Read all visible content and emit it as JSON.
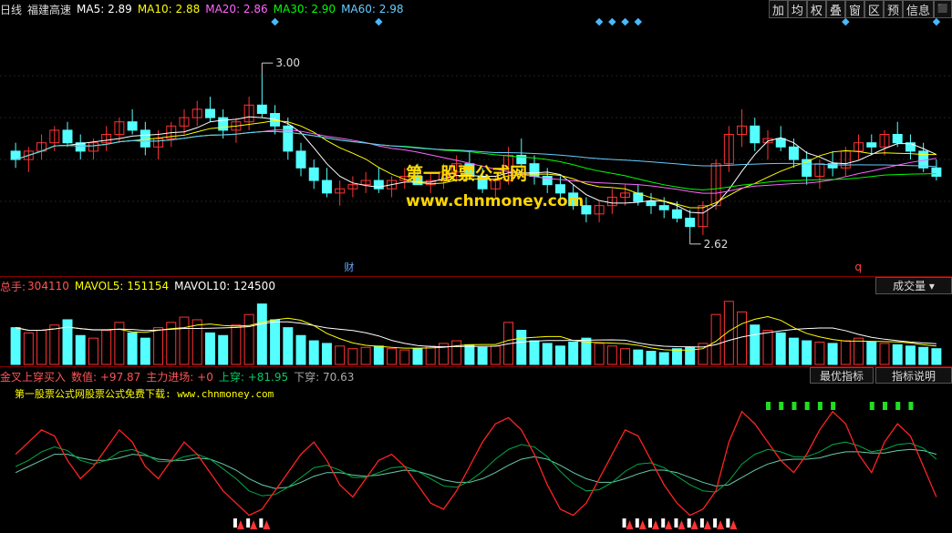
{
  "header": {
    "period": "日线",
    "stock": "福建高速",
    "ma": [
      {
        "label": "MA5: 2.89",
        "color": "#ffffff"
      },
      {
        "label": "MA10: 2.88",
        "color": "#ffff00"
      },
      {
        "label": "MA20: 2.86",
        "color": "#ff66ff"
      },
      {
        "label": "MA30: 2.90",
        "color": "#00ff00"
      },
      {
        "label": "MA60: 2.98",
        "color": "#66ccff"
      }
    ]
  },
  "toolbar": [
    "加",
    "均",
    "权",
    "叠",
    "窗",
    "区",
    "预",
    "信息",
    "⬛"
  ],
  "volume_panel": {
    "label_total": "总手:",
    "total_value": "304110",
    "mavol5": "MAVOL5: 151154",
    "mavol10": "MAVOL10: 124500",
    "selector": "成交量"
  },
  "indicator_panel": {
    "title": "金叉上穿买入",
    "value_label": "数值: +97.87",
    "main_flow": "主力进场: +0",
    "up_cross": "上穿: +81.95",
    "down_cross": "下穿: 70.63",
    "best_button": "最优指标",
    "help_button": "指标说明",
    "promo": "第一股票公式网股票公式免费下载: www.chnmoney.com"
  },
  "watermark": {
    "cn": "第一股票公式网",
    "url": "www.chnmoney.com"
  },
  "chart_data": {
    "type": "candlestick",
    "annotations": {
      "high": "3.00",
      "low": "2.62",
      "marker_cai": "财",
      "marker_q": "q"
    },
    "colors": {
      "up": "#ff3333",
      "down": "#54ffff",
      "ma5": "#ffffff",
      "ma10": "#ffff00",
      "ma20": "#ff66ff",
      "ma30": "#00ff00",
      "ma60": "#66ccff"
    },
    "ylim": [
      2.55,
      3.12
    ],
    "candles": [
      [
        2.82,
        2.84,
        2.78,
        2.8
      ],
      [
        2.8,
        2.83,
        2.77,
        2.82
      ],
      [
        2.82,
        2.86,
        2.8,
        2.84
      ],
      [
        2.84,
        2.88,
        2.82,
        2.87
      ],
      [
        2.87,
        2.89,
        2.83,
        2.84
      ],
      [
        2.84,
        2.86,
        2.8,
        2.82
      ],
      [
        2.82,
        2.85,
        2.8,
        2.84
      ],
      [
        2.84,
        2.88,
        2.82,
        2.86
      ],
      [
        2.86,
        2.9,
        2.84,
        2.89
      ],
      [
        2.89,
        2.92,
        2.86,
        2.87
      ],
      [
        2.87,
        2.89,
        2.81,
        2.83
      ],
      [
        2.83,
        2.87,
        2.8,
        2.85
      ],
      [
        2.85,
        2.89,
        2.83,
        2.88
      ],
      [
        2.88,
        2.92,
        2.86,
        2.9
      ],
      [
        2.9,
        2.94,
        2.88,
        2.92
      ],
      [
        2.92,
        2.95,
        2.89,
        2.9
      ],
      [
        2.9,
        2.92,
        2.85,
        2.87
      ],
      [
        2.87,
        2.9,
        2.84,
        2.89
      ],
      [
        2.89,
        2.95,
        2.87,
        2.93
      ],
      [
        2.93,
        3.0,
        2.9,
        2.91
      ],
      [
        2.91,
        2.93,
        2.86,
        2.88
      ],
      [
        2.88,
        2.9,
        2.8,
        2.82
      ],
      [
        2.82,
        2.84,
        2.76,
        2.78
      ],
      [
        2.78,
        2.8,
        2.73,
        2.75
      ],
      [
        2.75,
        2.78,
        2.71,
        2.72
      ],
      [
        2.72,
        2.75,
        2.69,
        2.73
      ],
      [
        2.73,
        2.76,
        2.71,
        2.74
      ],
      [
        2.74,
        2.77,
        2.72,
        2.75
      ],
      [
        2.75,
        2.78,
        2.72,
        2.73
      ],
      [
        2.73,
        2.76,
        2.71,
        2.75
      ],
      [
        2.75,
        2.78,
        2.73,
        2.76
      ],
      [
        2.76,
        2.79,
        2.74,
        2.74
      ],
      [
        2.74,
        2.77,
        2.72,
        2.75
      ],
      [
        2.75,
        2.79,
        2.73,
        2.77
      ],
      [
        2.77,
        2.81,
        2.75,
        2.79
      ],
      [
        2.79,
        2.82,
        2.75,
        2.76
      ],
      [
        2.76,
        2.78,
        2.72,
        2.73
      ],
      [
        2.73,
        2.76,
        2.71,
        2.75
      ],
      [
        2.75,
        2.83,
        2.74,
        2.81
      ],
      [
        2.81,
        2.85,
        2.78,
        2.79
      ],
      [
        2.79,
        2.81,
        2.74,
        2.76
      ],
      [
        2.76,
        2.78,
        2.72,
        2.74
      ],
      [
        2.74,
        2.76,
        2.7,
        2.72
      ],
      [
        2.72,
        2.74,
        2.68,
        2.69
      ],
      [
        2.69,
        2.71,
        2.65,
        2.67
      ],
      [
        2.67,
        2.7,
        2.65,
        2.69
      ],
      [
        2.69,
        2.73,
        2.67,
        2.71
      ],
      [
        2.71,
        2.74,
        2.69,
        2.72
      ],
      [
        2.72,
        2.74,
        2.69,
        2.7
      ],
      [
        2.7,
        2.72,
        2.67,
        2.69
      ],
      [
        2.69,
        2.71,
        2.66,
        2.68
      ],
      [
        2.68,
        2.7,
        2.65,
        2.66
      ],
      [
        2.66,
        2.68,
        2.62,
        2.64
      ],
      [
        2.64,
        2.7,
        2.62,
        2.69
      ],
      [
        2.69,
        2.8,
        2.68,
        2.79
      ],
      [
        2.79,
        2.88,
        2.77,
        2.86
      ],
      [
        2.86,
        2.92,
        2.83,
        2.88
      ],
      [
        2.88,
        2.9,
        2.82,
        2.84
      ],
      [
        2.84,
        2.87,
        2.8,
        2.85
      ],
      [
        2.85,
        2.88,
        2.82,
        2.83
      ],
      [
        2.83,
        2.85,
        2.78,
        2.8
      ],
      [
        2.8,
        2.82,
        2.74,
        2.76
      ],
      [
        2.76,
        2.8,
        2.73,
        2.79
      ],
      [
        2.79,
        2.82,
        2.76,
        2.78
      ],
      [
        2.78,
        2.83,
        2.76,
        2.82
      ],
      [
        2.82,
        2.86,
        2.8,
        2.84
      ],
      [
        2.84,
        2.86,
        2.81,
        2.83
      ],
      [
        2.83,
        2.87,
        2.81,
        2.86
      ],
      [
        2.86,
        2.89,
        2.83,
        2.84
      ],
      [
        2.84,
        2.86,
        2.8,
        2.82
      ],
      [
        2.82,
        2.84,
        2.77,
        2.78
      ],
      [
        2.78,
        2.8,
        2.75,
        2.76
      ]
    ],
    "volume": [
      140,
      120,
      130,
      150,
      170,
      110,
      100,
      130,
      160,
      120,
      100,
      140,
      160,
      180,
      170,
      120,
      110,
      150,
      190,
      230,
      170,
      140,
      110,
      90,
      80,
      70,
      60,
      65,
      70,
      60,
      55,
      60,
      70,
      80,
      90,
      75,
      65,
      70,
      160,
      130,
      90,
      80,
      70,
      85,
      100,
      80,
      70,
      60,
      55,
      50,
      45,
      60,
      65,
      80,
      190,
      240,
      200,
      150,
      130,
      120,
      100,
      90,
      85,
      80,
      90,
      100,
      85,
      80,
      75,
      70,
      65,
      60
    ],
    "volume_ylim": [
      0,
      260
    ],
    "indicator": {
      "ylim": [
        0,
        100
      ],
      "red_line": [
        60,
        70,
        80,
        75,
        55,
        40,
        50,
        65,
        80,
        70,
        50,
        40,
        55,
        70,
        60,
        45,
        30,
        20,
        10,
        15,
        30,
        45,
        60,
        70,
        55,
        35,
        25,
        40,
        55,
        60,
        50,
        35,
        20,
        15,
        30,
        50,
        70,
        85,
        90,
        80,
        60,
        35,
        15,
        10,
        20,
        40,
        60,
        80,
        75,
        55,
        35,
        20,
        10,
        15,
        30,
        70,
        95,
        85,
        70,
        55,
        45,
        60,
        80,
        95,
        85,
        60,
        45,
        70,
        85,
        75,
        50,
        25
      ],
      "green_line": [
        50,
        55,
        62,
        66,
        63,
        55,
        52,
        55,
        62,
        64,
        60,
        54,
        54,
        58,
        60,
        56,
        48,
        40,
        30,
        26,
        27,
        33,
        41,
        49,
        51,
        47,
        41,
        41,
        45,
        49,
        50,
        46,
        40,
        34,
        33,
        38,
        46,
        56,
        64,
        68,
        66,
        58,
        46,
        36,
        30,
        31,
        37,
        46,
        52,
        53,
        49,
        42,
        35,
        30,
        29,
        38,
        52,
        60,
        64,
        62,
        58,
        58,
        62,
        68,
        70,
        67,
        62,
        64,
        68,
        69,
        65,
        56
      ],
      "teal_line": [
        45,
        50,
        55,
        60,
        60,
        57,
        55,
        55,
        57,
        60,
        59,
        56,
        55,
        55,
        57,
        56,
        52,
        47,
        40,
        35,
        32,
        33,
        37,
        42,
        45,
        45,
        43,
        42,
        43,
        45,
        47,
        46,
        43,
        39,
        37,
        37,
        40,
        45,
        51,
        56,
        58,
        56,
        51,
        45,
        40,
        37,
        37,
        40,
        44,
        47,
        47,
        45,
        41,
        37,
        34,
        35,
        41,
        47,
        52,
        55,
        56,
        56,
        57,
        60,
        62,
        62,
        61,
        61,
        63,
        64,
        63,
        60
      ]
    },
    "signals": {
      "buy_white_idx": [
        17,
        18,
        19,
        47,
        48,
        49,
        50,
        51,
        52,
        53,
        54,
        55
      ],
      "green_top_idx": [
        58,
        59,
        60,
        61,
        62,
        63,
        66,
        67,
        68,
        69
      ]
    }
  }
}
